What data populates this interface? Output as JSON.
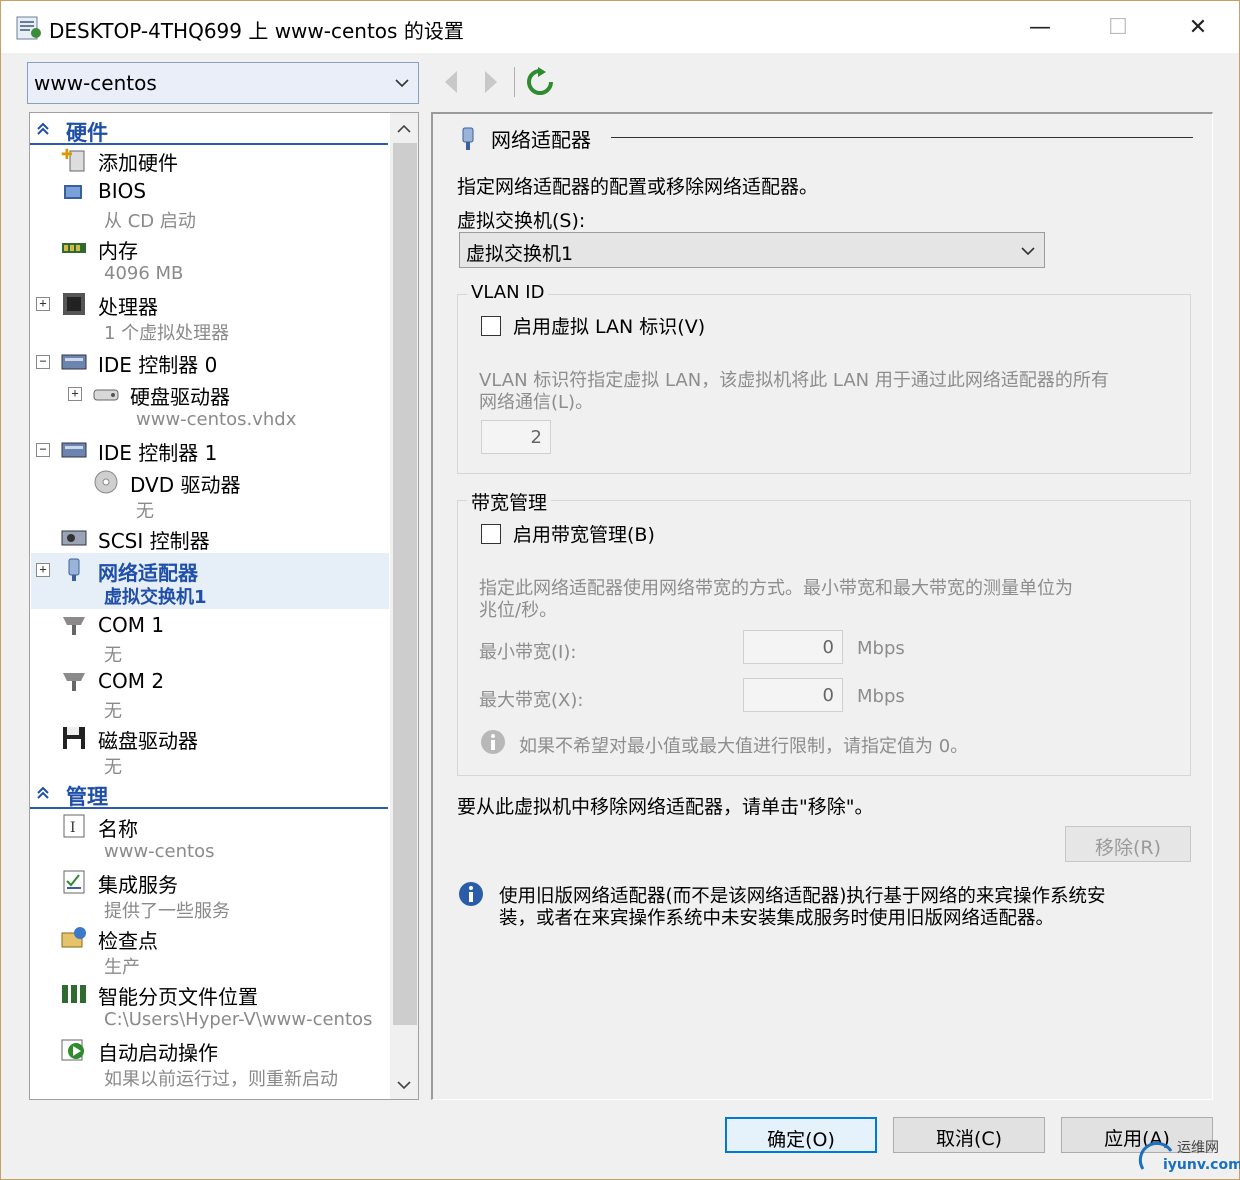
{
  "window": {
    "title": "DESKTOP-4THQ699 上 www-centos 的设置",
    "minimize": "—",
    "maximize": "☐",
    "close": "✕"
  },
  "vm_selector": {
    "value": "www-centos"
  },
  "tree": {
    "hardware_header": "硬件",
    "items": [
      {
        "label": "添加硬件",
        "sub": ""
      },
      {
        "label": "BIOS",
        "sub": "从 CD 启动"
      },
      {
        "label": "内存",
        "sub": "4096 MB"
      },
      {
        "label": "处理器",
        "sub": "1 个虚拟处理器",
        "expander": "+"
      },
      {
        "label": "IDE 控制器 0",
        "sub": "",
        "expander": "−"
      },
      {
        "label": "硬盘驱动器",
        "sub": "www-centos.vhdx",
        "expander": "+"
      },
      {
        "label": "IDE 控制器 1",
        "sub": "",
        "expander": "−"
      },
      {
        "label": "DVD 驱动器",
        "sub": "无"
      },
      {
        "label": "SCSI 控制器",
        "sub": ""
      },
      {
        "label": "网络适配器",
        "sub": "虚拟交换机1",
        "expander": "+"
      },
      {
        "label": "COM 1",
        "sub": "无"
      },
      {
        "label": "COM 2",
        "sub": "无"
      },
      {
        "label": "磁盘驱动器",
        "sub": "无"
      }
    ],
    "management_header": "管理",
    "mgmt_items": [
      {
        "label": "名称",
        "sub": "www-centos"
      },
      {
        "label": "集成服务",
        "sub": "提供了一些服务"
      },
      {
        "label": "检查点",
        "sub": "生产"
      },
      {
        "label": "智能分页文件位置",
        "sub": "C:\\Users\\Hyper-V\\www-centos"
      },
      {
        "label": "自动启动操作",
        "sub": "如果以前运行过，则重新启动"
      }
    ]
  },
  "panel": {
    "heading": "网络适配器",
    "description": "指定网络适配器的配置或移除网络适配器。",
    "switch_label": "虚拟交换机(S):",
    "switch_value": "虚拟交换机1",
    "vlan": {
      "group_title": "VLAN ID",
      "checkbox_label": "启用虚拟 LAN 标识(V)",
      "help_line1": "VLAN 标识符指定虚拟 LAN，该虚拟机将此 LAN 用于通过此网络适配器的所有",
      "help_line2": "网络通信(L)。",
      "value": "2"
    },
    "bandwidth": {
      "group_title": "带宽管理",
      "checkbox_label": "启用带宽管理(B)",
      "help_line1": "指定此网络适配器使用网络带宽的方式。最小带宽和最大带宽的测量单位为",
      "help_line2": "兆位/秒。",
      "min_label": "最小带宽(I):",
      "min_value": "0",
      "max_label": "最大带宽(X):",
      "max_value": "0",
      "unit": "Mbps",
      "note": "如果不希望对最小值或最大值进行限制，请指定值为 0。"
    },
    "remove_text": "要从此虚拟机中移除网络适配器，请单击\"移除\"。",
    "remove_button": "移除(R)",
    "legacy_info_line1": "使用旧版网络适配器(而不是该网络适配器)执行基于网络的来宾操作系统安",
    "legacy_info_line2": "装，或者在来宾操作系统中未安装集成服务时使用旧版网络适配器。"
  },
  "buttons": {
    "ok": "确定(O)",
    "cancel": "取消(C)",
    "apply": "应用(A)"
  },
  "watermark": {
    "line1": "运维网",
    "line2": "iyunv.com"
  },
  "colors": {
    "accent": "#1f4fa8",
    "selection": "#e6eef8",
    "default_button": "#0078d7"
  }
}
